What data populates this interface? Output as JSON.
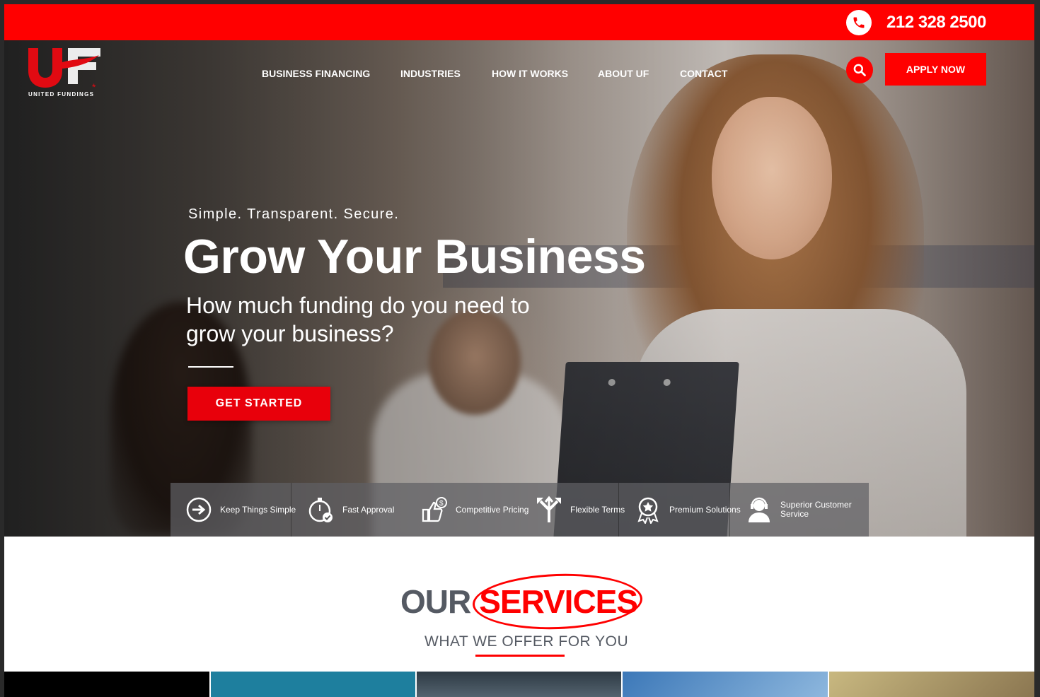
{
  "topbar": {
    "phone_icon": "phone-icon",
    "phone_number": "212 328 2500",
    "color": "#ff0000"
  },
  "header": {
    "logo_text": "UNITED FUNDINGS",
    "nav": [
      {
        "label": "BUSINESS FINANCING"
      },
      {
        "label": "INDUSTRIES"
      },
      {
        "label": "HOW IT WORKS"
      },
      {
        "label": "ABOUT UF"
      },
      {
        "label": "CONTACT"
      }
    ],
    "search_icon": "search-icon",
    "apply_label": "APPLY NOW"
  },
  "hero": {
    "tagline": "Simple. Transparent. Secure.",
    "headline": "Grow Your Business",
    "subhead": "How much funding do you need to grow your business?",
    "cta_label": "GET STARTED"
  },
  "features": [
    {
      "icon": "arrow-circle-icon",
      "label": "Keep Things Simple"
    },
    {
      "icon": "stopwatch-icon",
      "label": "Fast Approval"
    },
    {
      "icon": "thumbs-up-dollar-icon",
      "label": "Competitive Pricing"
    },
    {
      "icon": "split-arrows-icon",
      "label": "Flexible Terms"
    },
    {
      "icon": "award-badge-icon",
      "label": "Premium Solutions"
    },
    {
      "icon": "headset-agent-icon",
      "label": "Superior Customer Service"
    }
  ],
  "services": {
    "title_left": "OUR",
    "title_right": "SERVICES",
    "subtitle": "WHAT WE OFFER FOR YOU"
  },
  "tiles": [
    {
      "name": "service-tile-1",
      "color": "#000000"
    },
    {
      "name": "service-tile-2",
      "color": "#1e7f9e"
    },
    {
      "name": "service-tile-3",
      "color": "#3b4a55"
    },
    {
      "name": "service-tile-4",
      "color": "#5a8fc4"
    },
    {
      "name": "service-tile-5",
      "color": "#a89a6e"
    }
  ]
}
